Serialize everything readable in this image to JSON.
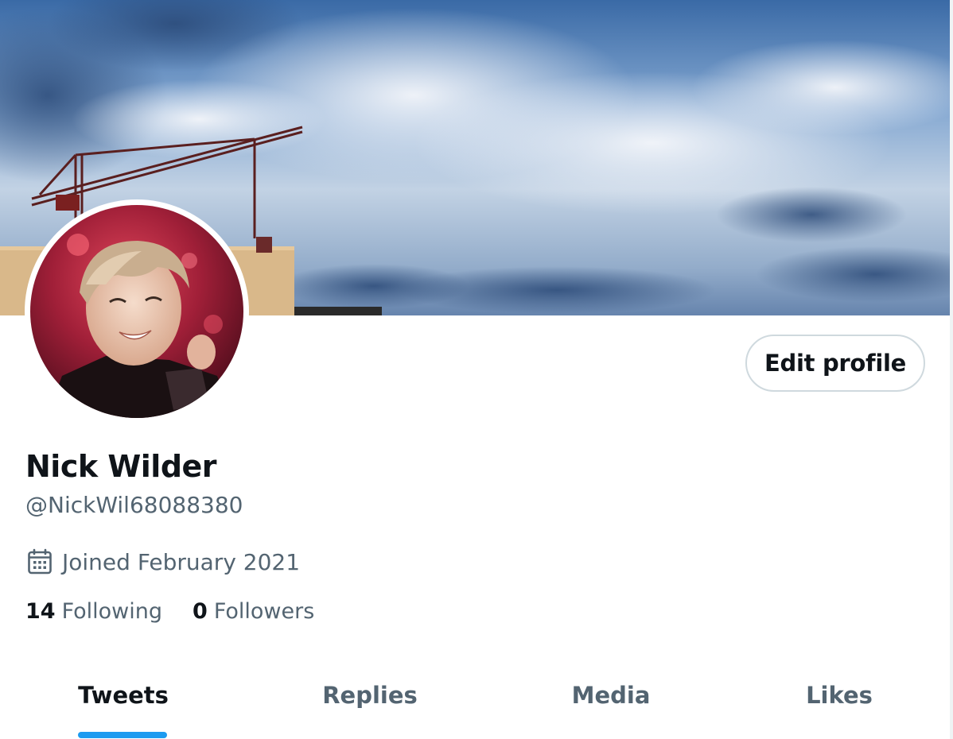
{
  "profile": {
    "display_name": "Nick Wilder",
    "handle": "@NickWil68088380",
    "joined": "Joined February 2021",
    "following_count": "14",
    "following_label": "Following",
    "followers_count": "0",
    "followers_label": "Followers"
  },
  "actions": {
    "edit_profile_label": "Edit profile"
  },
  "tabs": [
    {
      "label": "Tweets",
      "active": true
    },
    {
      "label": "Replies",
      "active": false
    },
    {
      "label": "Media",
      "active": false
    },
    {
      "label": "Likes",
      "active": false
    }
  ],
  "icons": {
    "joined": "calendar-icon"
  },
  "colors": {
    "accent": "#1d9bf0",
    "primary_text": "#0f1419",
    "secondary_text": "#536471",
    "border": "#cfd9de"
  }
}
